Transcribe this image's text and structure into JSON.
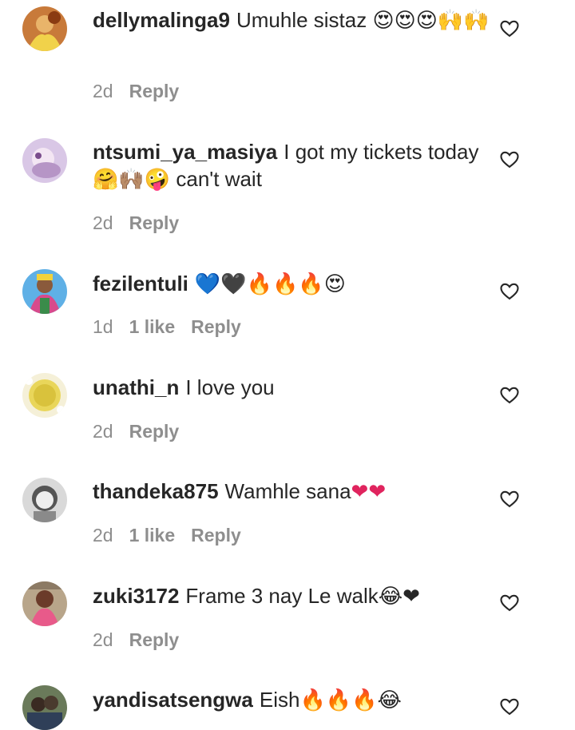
{
  "comments": [
    {
      "username": "dellymalinga9",
      "text": "Umuhle sistaz",
      "emoji": "😍😍😍🙌🙌",
      "time": "2d",
      "likes": "",
      "reply": "Reply"
    },
    {
      "username": "ntsumi_ya_masiya",
      "text": "I got my tickets today",
      "emoji": "🤗🙌🏽🤪",
      "text2": "can't wait",
      "time": "2d",
      "likes": "",
      "reply": "Reply"
    },
    {
      "username": "fezilentuli",
      "text": "",
      "emoji": "💙🖤🔥🔥🔥😍",
      "time": "1d",
      "likes": "1 like",
      "reply": "Reply"
    },
    {
      "username": "unathi_n",
      "text": "I love you",
      "emoji": "",
      "time": "2d",
      "likes": "",
      "reply": "Reply"
    },
    {
      "username": "thandeka875",
      "text": "Wamhle sana",
      "emoji": "❤❤",
      "time": "2d",
      "likes": "1 like",
      "reply": "Reply"
    },
    {
      "username": "zuki3172",
      "text": "Frame 3 nay Le walk",
      "emoji": "😂❤",
      "time": "2d",
      "likes": "",
      "reply": "Reply"
    },
    {
      "username": "yandisatsengwa",
      "text": "Eish",
      "emoji": "🔥🔥🔥😂",
      "time": "",
      "likes": "",
      "reply": ""
    }
  ],
  "colors": {
    "text": "#262626",
    "meta": "#8e8e8e",
    "heart": "#262626"
  },
  "icons": {
    "like": "heart-outline-icon"
  }
}
